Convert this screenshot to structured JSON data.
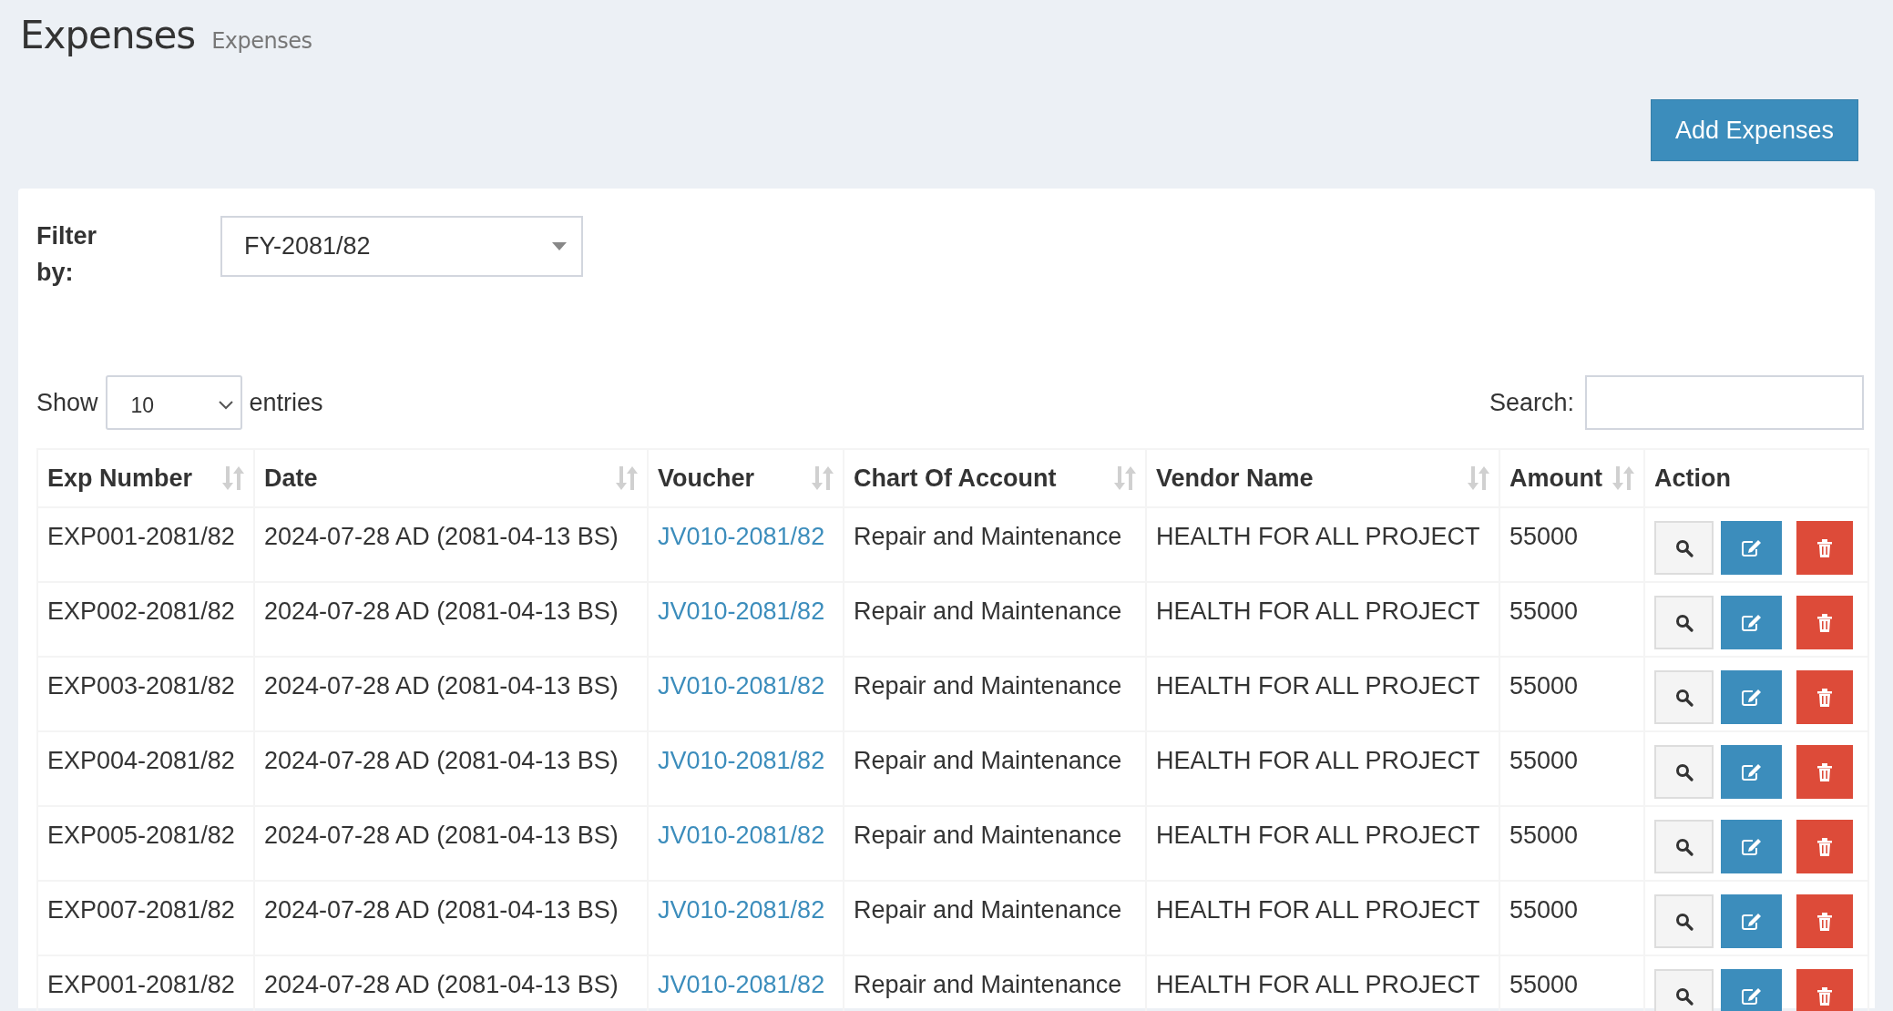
{
  "header": {
    "title": "Expenses",
    "subtitle": "Expenses"
  },
  "add_button": "Add Expenses",
  "filter": {
    "label": "Filter by:",
    "value": "FY-2081/82"
  },
  "page_length": {
    "label_before": "Show",
    "value": "10",
    "label_after": "entries"
  },
  "search": {
    "label": "Search:"
  },
  "table": {
    "columns": [
      {
        "label": "Exp Number",
        "sortable": true
      },
      {
        "label": "Date",
        "sortable": true
      },
      {
        "label": "Voucher",
        "sortable": true
      },
      {
        "label": "Chart Of Account",
        "sortable": true
      },
      {
        "label": "Vendor Name",
        "sortable": true
      },
      {
        "label": "Amount",
        "sortable": true
      },
      {
        "label": "Action",
        "sortable": false
      }
    ],
    "rows": [
      {
        "exp_number": "EXP001-2081/82",
        "date": "2024-07-28 AD (2081-04-13 BS)",
        "voucher": "JV010-2081/82",
        "account": "Repair and Maintenance",
        "vendor": "HEALTH FOR ALL PROJECT",
        "amount": "55000"
      },
      {
        "exp_number": "EXP002-2081/82",
        "date": "2024-07-28 AD (2081-04-13 BS)",
        "voucher": "JV010-2081/82",
        "account": "Repair and Maintenance",
        "vendor": "HEALTH FOR ALL PROJECT",
        "amount": "55000"
      },
      {
        "exp_number": "EXP003-2081/82",
        "date": "2024-07-28 AD (2081-04-13 BS)",
        "voucher": "JV010-2081/82",
        "account": "Repair and Maintenance",
        "vendor": "HEALTH FOR ALL PROJECT",
        "amount": "55000"
      },
      {
        "exp_number": "EXP004-2081/82",
        "date": "2024-07-28 AD (2081-04-13 BS)",
        "voucher": "JV010-2081/82",
        "account": "Repair and Maintenance",
        "vendor": "HEALTH FOR ALL PROJECT",
        "amount": "55000"
      },
      {
        "exp_number": "EXP005-2081/82",
        "date": "2024-07-28 AD (2081-04-13 BS)",
        "voucher": "JV010-2081/82",
        "account": "Repair and Maintenance",
        "vendor": "HEALTH FOR ALL PROJECT",
        "amount": "55000"
      },
      {
        "exp_number": "EXP007-2081/82",
        "date": "2024-07-28 AD (2081-04-13 BS)",
        "voucher": "JV010-2081/82",
        "account": "Repair and Maintenance",
        "vendor": "HEALTH FOR ALL PROJECT",
        "amount": "55000"
      },
      {
        "exp_number": "EXP001-2081/82",
        "date": "2024-07-28 AD (2081-04-13 BS)",
        "voucher": "JV010-2081/82",
        "account": "Repair and Maintenance",
        "vendor": "HEALTH FOR ALL PROJECT",
        "amount": "55000"
      }
    ]
  }
}
